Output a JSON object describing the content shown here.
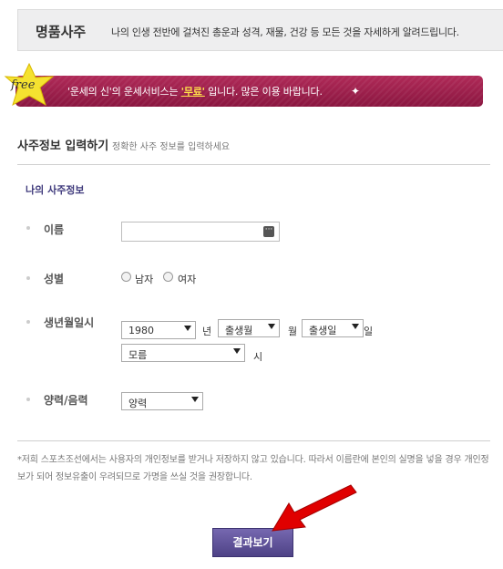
{
  "header": {
    "title": "명품사주",
    "description": "나의 인생 전반에 걸쳐진 총운과 성격, 재물, 건강 등 모든 것을 자세하게 알려드립니다."
  },
  "banner": {
    "badge": "free",
    "text_before": "'운세의 신'의 운세서비스는 ",
    "highlight": "'무료'",
    "text_after": " 입니다. 많은 이용 바랍니다."
  },
  "section": {
    "title": "사주정보 입력하기",
    "subtitle": "정확한 사주 정보를 입력하세요",
    "my_info_label": "나의 사주정보"
  },
  "form": {
    "name_label": "이름",
    "name_value": "",
    "gender_label": "성별",
    "gender_options": [
      "남자",
      "여자"
    ],
    "birth_label": "생년월일시",
    "year_value": "1980",
    "year_unit": "년",
    "month_value": "출생월",
    "month_unit": "월",
    "day_value": "출생일",
    "day_unit": "일",
    "hour_value": "모름",
    "hour_unit": "시",
    "calendar_label": "양력/음력",
    "calendar_value": "양력"
  },
  "notice": "*저희 스포츠조선에서는 사용자의 개인정보를 받거나 저장하지 않고 있습니다. 따라서 이름란에 본인의 실명을 넣을 경우 개인정보가 되어 정보유출이 우려되므로 가명을 쓰실 것을 권장합니다.",
  "submit_label": "결과보기",
  "colors": {
    "banner": "#9b1c4a",
    "highlight": "#ffe14a",
    "button": "#5a4e92",
    "section_label": "#3f3a7c",
    "arrow": "#e00000"
  }
}
